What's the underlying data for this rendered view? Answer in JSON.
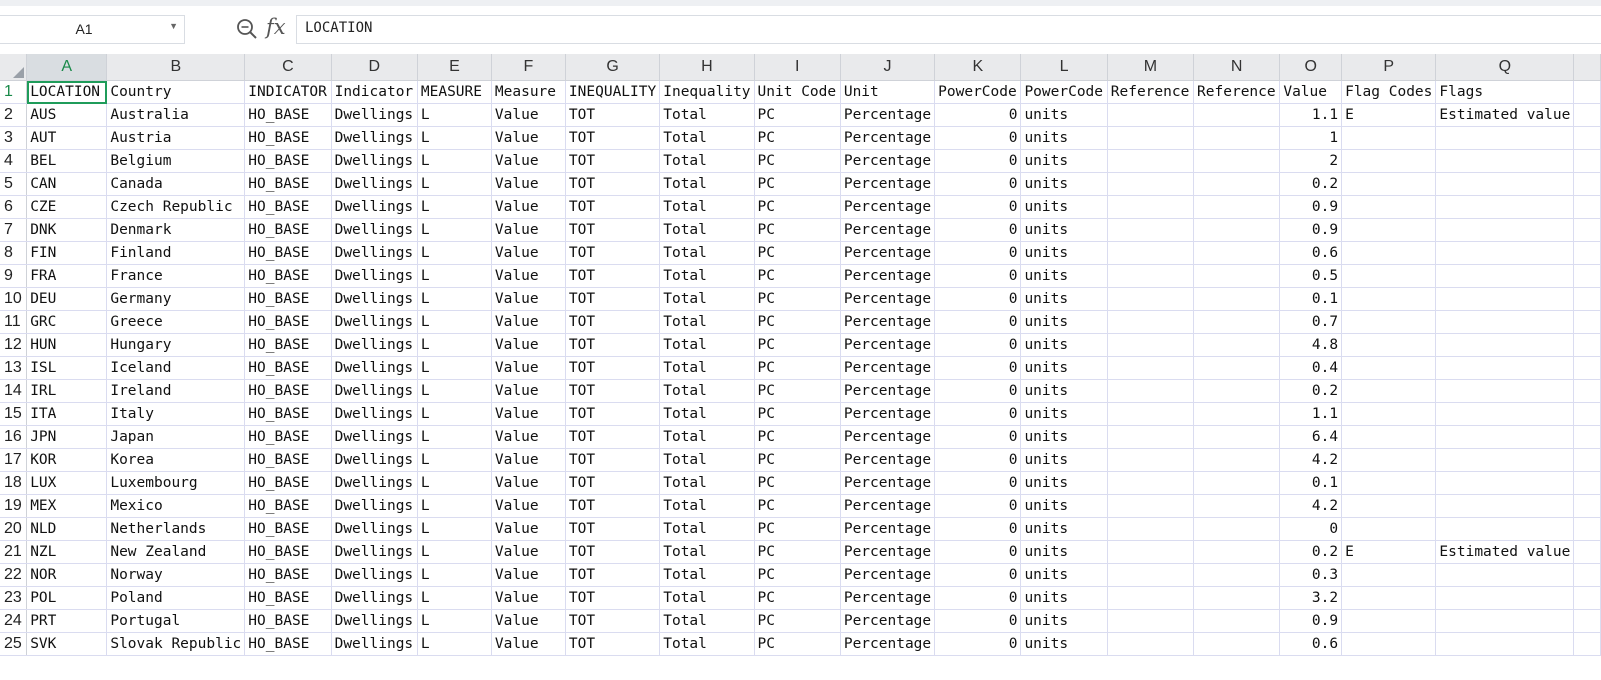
{
  "formula_bar": {
    "name_box": "A1",
    "formula": "LOCATION",
    "fx_label": "fx"
  },
  "columns": [
    "A",
    "B",
    "C",
    "D",
    "E",
    "F",
    "G",
    "H",
    "I",
    "J",
    "K",
    "L",
    "M",
    "N",
    "O",
    "P",
    "Q",
    ""
  ],
  "rows": [
    {
      "n": "1",
      "cells": [
        "LOCATION",
        "Country",
        "INDICATOR",
        "Indicator",
        "MEASURE",
        "Measure",
        "INEQUALITY",
        "Inequality",
        "Unit Code",
        "Unit",
        "PowerCode",
        "PowerCode",
        "Reference",
        "Reference",
        "Value",
        "Flag Codes",
        "Flags",
        ""
      ]
    },
    {
      "n": "2",
      "cells": [
        "AUS",
        "Australia",
        "HO_BASE",
        "Dwellings",
        "L",
        "Value",
        "TOT",
        "Total",
        "PC",
        "Percentage",
        "0",
        "units",
        "",
        "",
        "1.1",
        "E",
        "Estimated value",
        ""
      ]
    },
    {
      "n": "3",
      "cells": [
        "AUT",
        "Austria",
        "HO_BASE",
        "Dwellings",
        "L",
        "Value",
        "TOT",
        "Total",
        "PC",
        "Percentage",
        "0",
        "units",
        "",
        "",
        "1",
        "",
        "",
        ""
      ]
    },
    {
      "n": "4",
      "cells": [
        "BEL",
        "Belgium",
        "HO_BASE",
        "Dwellings",
        "L",
        "Value",
        "TOT",
        "Total",
        "PC",
        "Percentage",
        "0",
        "units",
        "",
        "",
        "2",
        "",
        "",
        ""
      ]
    },
    {
      "n": "5",
      "cells": [
        "CAN",
        "Canada",
        "HO_BASE",
        "Dwellings",
        "L",
        "Value",
        "TOT",
        "Total",
        "PC",
        "Percentage",
        "0",
        "units",
        "",
        "",
        "0.2",
        "",
        "",
        ""
      ]
    },
    {
      "n": "6",
      "cells": [
        "CZE",
        "Czech Republic",
        "HO_BASE",
        "Dwellings",
        "L",
        "Value",
        "TOT",
        "Total",
        "PC",
        "Percentage",
        "0",
        "units",
        "",
        "",
        "0.9",
        "",
        "",
        ""
      ]
    },
    {
      "n": "7",
      "cells": [
        "DNK",
        "Denmark",
        "HO_BASE",
        "Dwellings",
        "L",
        "Value",
        "TOT",
        "Total",
        "PC",
        "Percentage",
        "0",
        "units",
        "",
        "",
        "0.9",
        "",
        "",
        ""
      ]
    },
    {
      "n": "8",
      "cells": [
        "FIN",
        "Finland",
        "HO_BASE",
        "Dwellings",
        "L",
        "Value",
        "TOT",
        "Total",
        "PC",
        "Percentage",
        "0",
        "units",
        "",
        "",
        "0.6",
        "",
        "",
        ""
      ]
    },
    {
      "n": "9",
      "cells": [
        "FRA",
        "France",
        "HO_BASE",
        "Dwellings",
        "L",
        "Value",
        "TOT",
        "Total",
        "PC",
        "Percentage",
        "0",
        "units",
        "",
        "",
        "0.5",
        "",
        "",
        ""
      ]
    },
    {
      "n": "10",
      "cells": [
        "DEU",
        "Germany",
        "HO_BASE",
        "Dwellings",
        "L",
        "Value",
        "TOT",
        "Total",
        "PC",
        "Percentage",
        "0",
        "units",
        "",
        "",
        "0.1",
        "",
        "",
        ""
      ]
    },
    {
      "n": "11",
      "cells": [
        "GRC",
        "Greece",
        "HO_BASE",
        "Dwellings",
        "L",
        "Value",
        "TOT",
        "Total",
        "PC",
        "Percentage",
        "0",
        "units",
        "",
        "",
        "0.7",
        "",
        "",
        ""
      ]
    },
    {
      "n": "12",
      "cells": [
        "HUN",
        "Hungary",
        "HO_BASE",
        "Dwellings",
        "L",
        "Value",
        "TOT",
        "Total",
        "PC",
        "Percentage",
        "0",
        "units",
        "",
        "",
        "4.8",
        "",
        "",
        ""
      ]
    },
    {
      "n": "13",
      "cells": [
        "ISL",
        "Iceland",
        "HO_BASE",
        "Dwellings",
        "L",
        "Value",
        "TOT",
        "Total",
        "PC",
        "Percentage",
        "0",
        "units",
        "",
        "",
        "0.4",
        "",
        "",
        ""
      ]
    },
    {
      "n": "14",
      "cells": [
        "IRL",
        "Ireland",
        "HO_BASE",
        "Dwellings",
        "L",
        "Value",
        "TOT",
        "Total",
        "PC",
        "Percentage",
        "0",
        "units",
        "",
        "",
        "0.2",
        "",
        "",
        ""
      ]
    },
    {
      "n": "15",
      "cells": [
        "ITA",
        "Italy",
        "HO_BASE",
        "Dwellings",
        "L",
        "Value",
        "TOT",
        "Total",
        "PC",
        "Percentage",
        "0",
        "units",
        "",
        "",
        "1.1",
        "",
        "",
        ""
      ]
    },
    {
      "n": "16",
      "cells": [
        "JPN",
        "Japan",
        "HO_BASE",
        "Dwellings",
        "L",
        "Value",
        "TOT",
        "Total",
        "PC",
        "Percentage",
        "0",
        "units",
        "",
        "",
        "6.4",
        "",
        "",
        ""
      ]
    },
    {
      "n": "17",
      "cells": [
        "KOR",
        "Korea",
        "HO_BASE",
        "Dwellings",
        "L",
        "Value",
        "TOT",
        "Total",
        "PC",
        "Percentage",
        "0",
        "units",
        "",
        "",
        "4.2",
        "",
        "",
        ""
      ]
    },
    {
      "n": "18",
      "cells": [
        "LUX",
        "Luxembourg",
        "HO_BASE",
        "Dwellings",
        "L",
        "Value",
        "TOT",
        "Total",
        "PC",
        "Percentage",
        "0",
        "units",
        "",
        "",
        "0.1",
        "",
        "",
        ""
      ]
    },
    {
      "n": "19",
      "cells": [
        "MEX",
        "Mexico",
        "HO_BASE",
        "Dwellings",
        "L",
        "Value",
        "TOT",
        "Total",
        "PC",
        "Percentage",
        "0",
        "units",
        "",
        "",
        "4.2",
        "",
        "",
        ""
      ]
    },
    {
      "n": "20",
      "cells": [
        "NLD",
        "Netherlands",
        "HO_BASE",
        "Dwellings",
        "L",
        "Value",
        "TOT",
        "Total",
        "PC",
        "Percentage",
        "0",
        "units",
        "",
        "",
        "0",
        "",
        "",
        ""
      ]
    },
    {
      "n": "21",
      "cells": [
        "NZL",
        "New Zealand",
        "HO_BASE",
        "Dwellings",
        "L",
        "Value",
        "TOT",
        "Total",
        "PC",
        "Percentage",
        "0",
        "units",
        "",
        "",
        "0.2",
        "E",
        "Estimated value",
        ""
      ]
    },
    {
      "n": "22",
      "cells": [
        "NOR",
        "Norway",
        "HO_BASE",
        "Dwellings",
        "L",
        "Value",
        "TOT",
        "Total",
        "PC",
        "Percentage",
        "0",
        "units",
        "",
        "",
        "0.3",
        "",
        "",
        ""
      ]
    },
    {
      "n": "23",
      "cells": [
        "POL",
        "Poland",
        "HO_BASE",
        "Dwellings",
        "L",
        "Value",
        "TOT",
        "Total",
        "PC",
        "Percentage",
        "0",
        "units",
        "",
        "",
        "3.2",
        "",
        "",
        ""
      ]
    },
    {
      "n": "24",
      "cells": [
        "PRT",
        "Portugal",
        "HO_BASE",
        "Dwellings",
        "L",
        "Value",
        "TOT",
        "Total",
        "PC",
        "Percentage",
        "0",
        "units",
        "",
        "",
        "0.9",
        "",
        "",
        ""
      ]
    },
    {
      "n": "25",
      "cells": [
        "SVK",
        "Slovak Republic",
        "HO_BASE",
        "Dwellings",
        "L",
        "Value",
        "TOT",
        "Total",
        "PC",
        "Percentage",
        "0",
        "units",
        "",
        "",
        "0.6",
        "",
        "",
        ""
      ]
    }
  ],
  "selected": {
    "row": "1",
    "col": "A"
  },
  "colors": {
    "selection": "#1f9c5a",
    "header_bg": "#e9eaec",
    "gridline": "#dadcf0"
  }
}
